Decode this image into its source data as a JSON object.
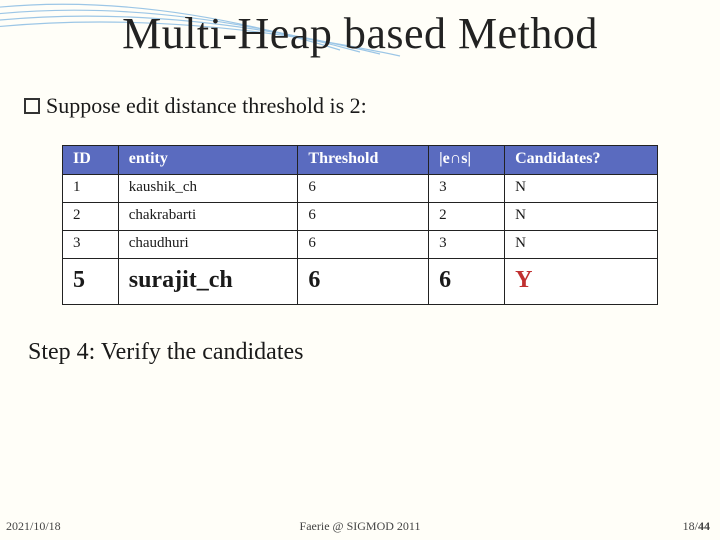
{
  "title": "Multi-Heap based Method",
  "bullet": "Suppose edit distance threshold is 2:",
  "table": {
    "headers": [
      "ID",
      "entity",
      "Threshold",
      "|e∩s|",
      "Candidates?"
    ],
    "rows": [
      {
        "id": "1",
        "entity": "kaushik_ch",
        "threshold": "6",
        "es": "3",
        "cand": "N",
        "big": false
      },
      {
        "id": "2",
        "entity": "chakrabarti",
        "threshold": "6",
        "es": "2",
        "cand": "N",
        "big": false
      },
      {
        "id": "3",
        "entity": "chaudhuri",
        "threshold": "6",
        "es": "3",
        "cand": "N",
        "big": false
      },
      {
        "id": "5",
        "entity": "surajit_ch",
        "threshold": "6",
        "es": "6",
        "cand": "Y",
        "big": true
      }
    ]
  },
  "step": "Step 4: Verify the candidates",
  "footer": {
    "date": "2021/10/18",
    "venue": "Faerie @ SIGMOD 2011",
    "page": "18/",
    "total": "44"
  }
}
